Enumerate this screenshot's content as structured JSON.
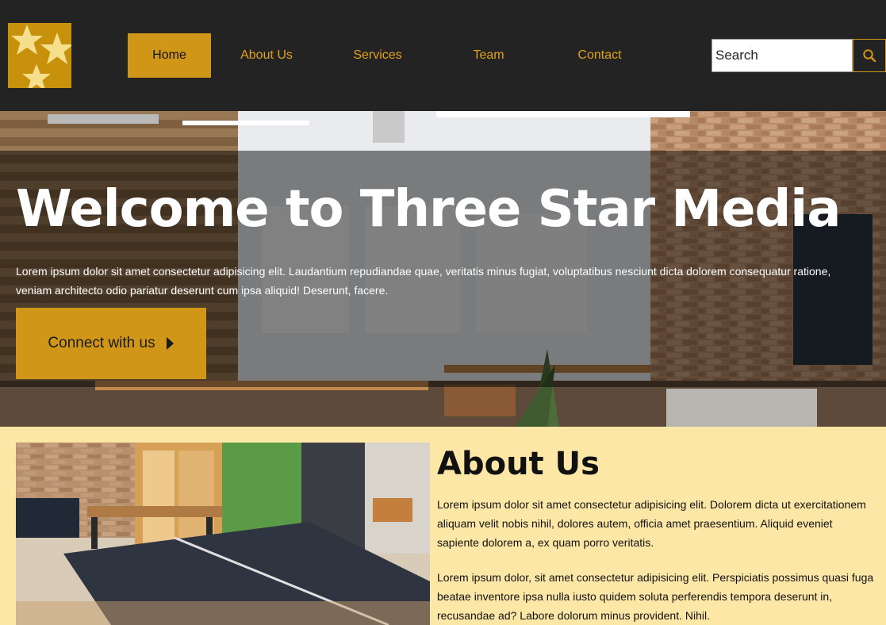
{
  "brand": {
    "logo_icon": "three-stars-logo",
    "colors": {
      "accent": "#d09617",
      "header_bg": "#232323",
      "page_bg": "#fde7a7"
    }
  },
  "nav": {
    "items": [
      {
        "label": "Home",
        "active": true
      },
      {
        "label": "About Us",
        "active": false
      },
      {
        "label": "Services",
        "active": false
      },
      {
        "label": "Team",
        "active": false
      },
      {
        "label": "Contact",
        "active": false
      }
    ]
  },
  "search": {
    "placeholder": "Search",
    "icon": "search-icon"
  },
  "hero": {
    "title": "Welcome to Three Star Media",
    "text": "Lorem ipsum dolor sit amet consectetur adipisicing elit. Laudantium repudiandae quae, veritatis minus fugiat, voluptatibus nesciunt dicta dolorem consequatur ratione, veniam architecto odio pariatur deserunt cum ipsa aliquid! Deserunt, facere.",
    "button_label": "Connect with us",
    "button_icon": "caret-right-icon"
  },
  "about": {
    "title": "About Us",
    "paragraph1": "Lorem ipsum dolor sit amet consectetur adipisicing elit. Dolorem dicta ut exercitationem aliquam velit nobis nihil, dolores autem, officia amet praesentium. Aliquid eveniet sapiente dolorem a, ex quam porro veritatis.",
    "paragraph2": "Lorem ipsum dolor, sit amet consectetur adipisicing elit. Perspiciatis possimus quasi fuga beatae inventore ipsa nulla iusto quidem soluta perferendis tempora deserunt in, recusandae ad? Labore dolorum minus provident. Nihil."
  }
}
